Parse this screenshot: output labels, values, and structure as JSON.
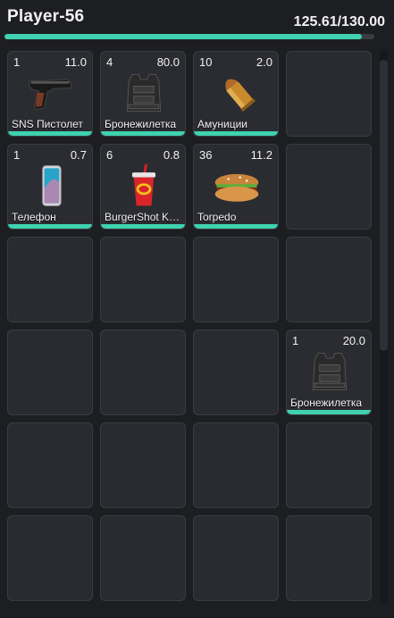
{
  "header": {
    "player_name": "Player-56",
    "weight_text": "125.61/130.00",
    "weight_fraction": 0.9662
  },
  "slots": [
    {
      "count": "1",
      "weight": "11.0",
      "label": "SNS Пистолет",
      "icon": "pistol-icon"
    },
    {
      "count": "4",
      "weight": "80.0",
      "label": "Бронежилетка",
      "icon": "body-armor-icon"
    },
    {
      "count": "10",
      "weight": "2.0",
      "label": "Амуниции",
      "icon": "ammo-icon"
    },
    null,
    {
      "count": "1",
      "weight": "0.7",
      "label": "Телефон",
      "icon": "phone-icon"
    },
    {
      "count": "6",
      "weight": "0.8",
      "label": "BurgerShot K…",
      "icon": "drink-cup-icon"
    },
    {
      "count": "36",
      "weight": "11.2",
      "label": "Torpedo",
      "icon": "sandwich-icon"
    },
    null,
    null,
    null,
    null,
    null,
    null,
    null,
    null,
    {
      "count": "1",
      "weight": "20.0",
      "label": "Бронежилетка",
      "icon": "body-armor-icon"
    },
    null,
    null,
    null,
    null,
    null,
    null,
    null,
    null
  ],
  "colors": {
    "accent": "#3fd1b0",
    "slot_bg": "#2a2b30",
    "slot_border": "#3a3c42",
    "panel_bg": "#1d1e22"
  }
}
